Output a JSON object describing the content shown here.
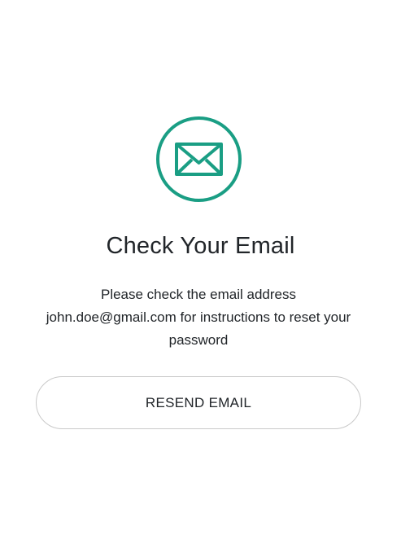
{
  "icon": {
    "name": "mail-envelope-icon",
    "accent_color": "#1a9e84"
  },
  "title": "Check Your Email",
  "message": {
    "line1": "Please check the email address",
    "line2": "john.doe@gmail.com for instructions to reset your",
    "line3": "password"
  },
  "resend_button": {
    "label": "RESEND EMAIL"
  }
}
